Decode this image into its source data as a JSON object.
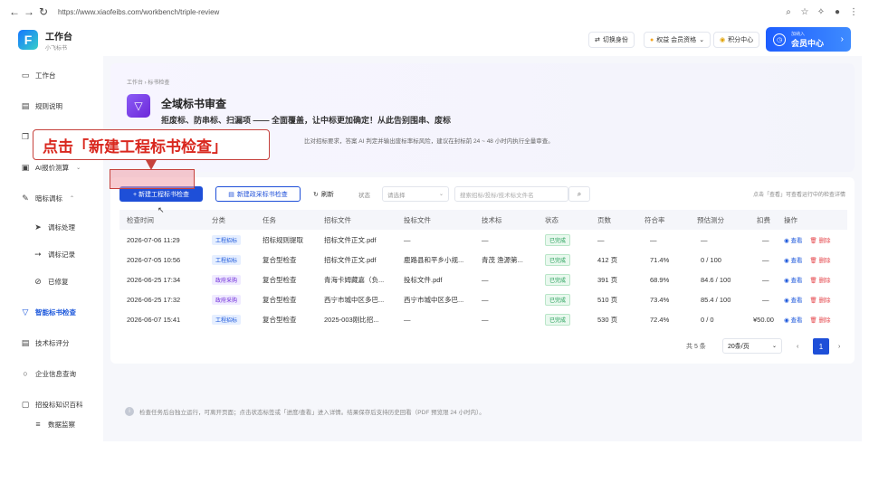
{
  "browser": {
    "url": "https://www.xiaofeibs.com/workbench/triple-review"
  },
  "topbar": {
    "logo_letter": "F",
    "brand_title": "工作台",
    "brand_sub": "小飞标书",
    "switch_identity": "切换身份",
    "member_level": "权益  会员资格",
    "points": "积分中心",
    "member_small": "加纳入",
    "member_center": "会员中心"
  },
  "sidebar": {
    "items": [
      {
        "icon": "desktop-icon",
        "glyph": "▭",
        "label": "工作台"
      },
      {
        "icon": "doc-icon",
        "glyph": "▤",
        "label": "规则说明"
      },
      {
        "icon": "copy-icon",
        "glyph": "❐",
        "label": ""
      },
      {
        "icon": "calc-icon",
        "glyph": "▣",
        "label": "AI报价测算"
      },
      {
        "icon": "wrench-icon",
        "glyph": "✎",
        "label": "暗标调标"
      },
      {
        "icon": "send-icon",
        "glyph": "➤",
        "label": "调标处理"
      },
      {
        "icon": "arrow-icon",
        "glyph": "➙",
        "label": "调标记录"
      },
      {
        "icon": "check-circle-icon",
        "glyph": "⊘",
        "label": "已修复"
      },
      {
        "icon": "filter-icon",
        "glyph": "▽",
        "label": "智能标书检查"
      },
      {
        "icon": "clipboard-icon",
        "glyph": "▤",
        "label": "技术标评分"
      },
      {
        "icon": "search-icon",
        "glyph": "○",
        "label": "企业信息查询"
      },
      {
        "icon": "book-icon",
        "glyph": "▢",
        "label": "招投标知识百科"
      },
      {
        "icon": "list-icon",
        "glyph": "≡",
        "label": "数据监察"
      }
    ]
  },
  "banner": {
    "breadcrumb": "工作台 › 标书检查",
    "title": "全域标书审查",
    "subtitle": "拒废标、防串标、扫漏项 —— 全面覆盖，让中标更加确定！从此告别围串、废标",
    "desc": "比对招标要求，答案 AI 判定并输出废标率标风险，建议在封标前 24 ~ 48 小时内执行全量审查。"
  },
  "callout": "点击「新建工程标书检查」",
  "toolbar": {
    "new_engineering": "+ 新建工程标书检查",
    "new_gov": "新建政采标书检查",
    "refresh": "刷新",
    "status_label": "状态",
    "status_placeholder": "请选择",
    "search_placeholder": "搜索招标/投标/技术标文件名",
    "hint": "点击「查看」可查看运行中的检查详情"
  },
  "table": {
    "headers": [
      "检查时间",
      "分类",
      "任务",
      "招标文件",
      "投标文件",
      "技术标",
      "状态",
      "页数",
      "符合率",
      "预估测分",
      "扣费",
      "操作"
    ],
    "rows": [
      {
        "time": "2026-07-06 11:29",
        "cat": "工程招标",
        "cat_type": "eng",
        "task": "招标规则提取",
        "tender": "招标文件正文.pdf",
        "bid": "—",
        "tech": "—",
        "status": "已完成",
        "pages": "—",
        "rate": "—",
        "score": "—",
        "fee": "—"
      },
      {
        "time": "2026-07-05 10:56",
        "cat": "工程招标",
        "cat_type": "eng",
        "task": "复合型检查",
        "tender": "招标文件正文.pdf",
        "bid": "鹿路县和平乡小规...",
        "tech": "青茂 渔源第...",
        "status": "已完成",
        "pages": "412 页",
        "rate": "71.4%",
        "score": "0 / 100",
        "fee": "—"
      },
      {
        "time": "2026-06-25 17:34",
        "cat": "政府采购",
        "cat_type": "gov",
        "task": "复合型检查",
        "tender": "青海卡姆藏嘉（负...",
        "bid": "投标文件.pdf",
        "tech": "—",
        "status": "已完成",
        "pages": "391 页",
        "rate": "68.9%",
        "score": "84.6 / 100",
        "fee": "—"
      },
      {
        "time": "2026-06-25 17:32",
        "cat": "政府采购",
        "cat_type": "gov",
        "task": "复合型检查",
        "tender": "西宁市城中区多巴...",
        "bid": "西宁市城中区多巴...",
        "tech": "—",
        "status": "已完成",
        "pages": "510 页",
        "rate": "73.4%",
        "score": "85.4 / 100",
        "fee": "—"
      },
      {
        "time": "2026-06-07 15:41",
        "cat": "工程招标",
        "cat_type": "eng",
        "task": "复合型检查",
        "tender": "2025-003刚比招...",
        "bid": "—",
        "tech": "—",
        "status": "已完成",
        "pages": "530 页",
        "rate": "72.4%",
        "score": "0 / 0",
        "fee": "¥50.00"
      }
    ],
    "view": "查看",
    "delete": "删除"
  },
  "pager": {
    "total": "共 5 条",
    "page_size": "20条/页",
    "current": "1",
    "prev": "‹",
    "next": "›"
  },
  "footer_note": "检查任务后台独立运行，可离开页面；点击状态标签或「进度/查看」进入详情。结果保存后支持历史回看（PDF 预览限 24 小时内）。"
}
